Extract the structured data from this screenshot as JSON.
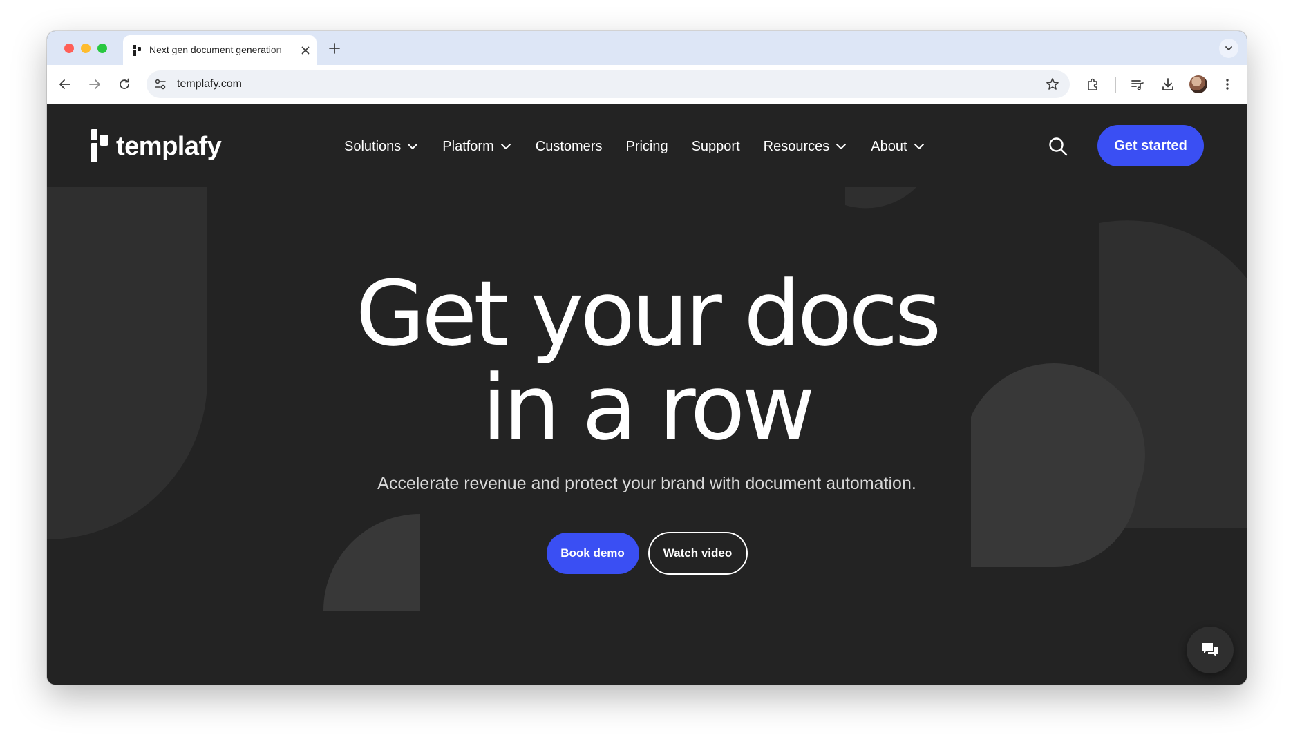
{
  "browser": {
    "tab_title": "Next gen document generation",
    "url": "templafy.com"
  },
  "site": {
    "logo_text": "templafy",
    "nav": [
      {
        "label": "Solutions",
        "has_dropdown": true
      },
      {
        "label": "Platform",
        "has_dropdown": true
      },
      {
        "label": "Customers",
        "has_dropdown": false
      },
      {
        "label": "Pricing",
        "has_dropdown": false
      },
      {
        "label": "Support",
        "has_dropdown": false
      },
      {
        "label": "Resources",
        "has_dropdown": true
      },
      {
        "label": "About",
        "has_dropdown": true
      }
    ],
    "cta_label": "Get started"
  },
  "hero": {
    "title_line1": "Get your docs",
    "title_line2": "in a row",
    "subtitle": "Accelerate revenue and protect your brand with document automation.",
    "primary_cta": "Book demo",
    "secondary_cta": "Watch video"
  },
  "icons": {
    "tab_close": "close-icon",
    "new_tab": "plus-icon",
    "tab_menu": "chevron-down-icon",
    "back": "arrow-left-icon",
    "forward": "arrow-right-icon",
    "reload": "reload-icon",
    "site_settings": "tune-icon",
    "bookmark": "star-icon",
    "extensions": "puzzle-icon",
    "reading_list": "reading-list-icon",
    "downloads": "download-icon",
    "profile": "avatar",
    "menu": "kebab-menu-icon",
    "search": "search-icon",
    "chat": "chat-icon"
  },
  "colors": {
    "brand_blue": "#3a4ff3",
    "page_bg": "#232323",
    "shape_gray": "#2f2f2f",
    "tabbar_bg": "#dde6f6"
  }
}
